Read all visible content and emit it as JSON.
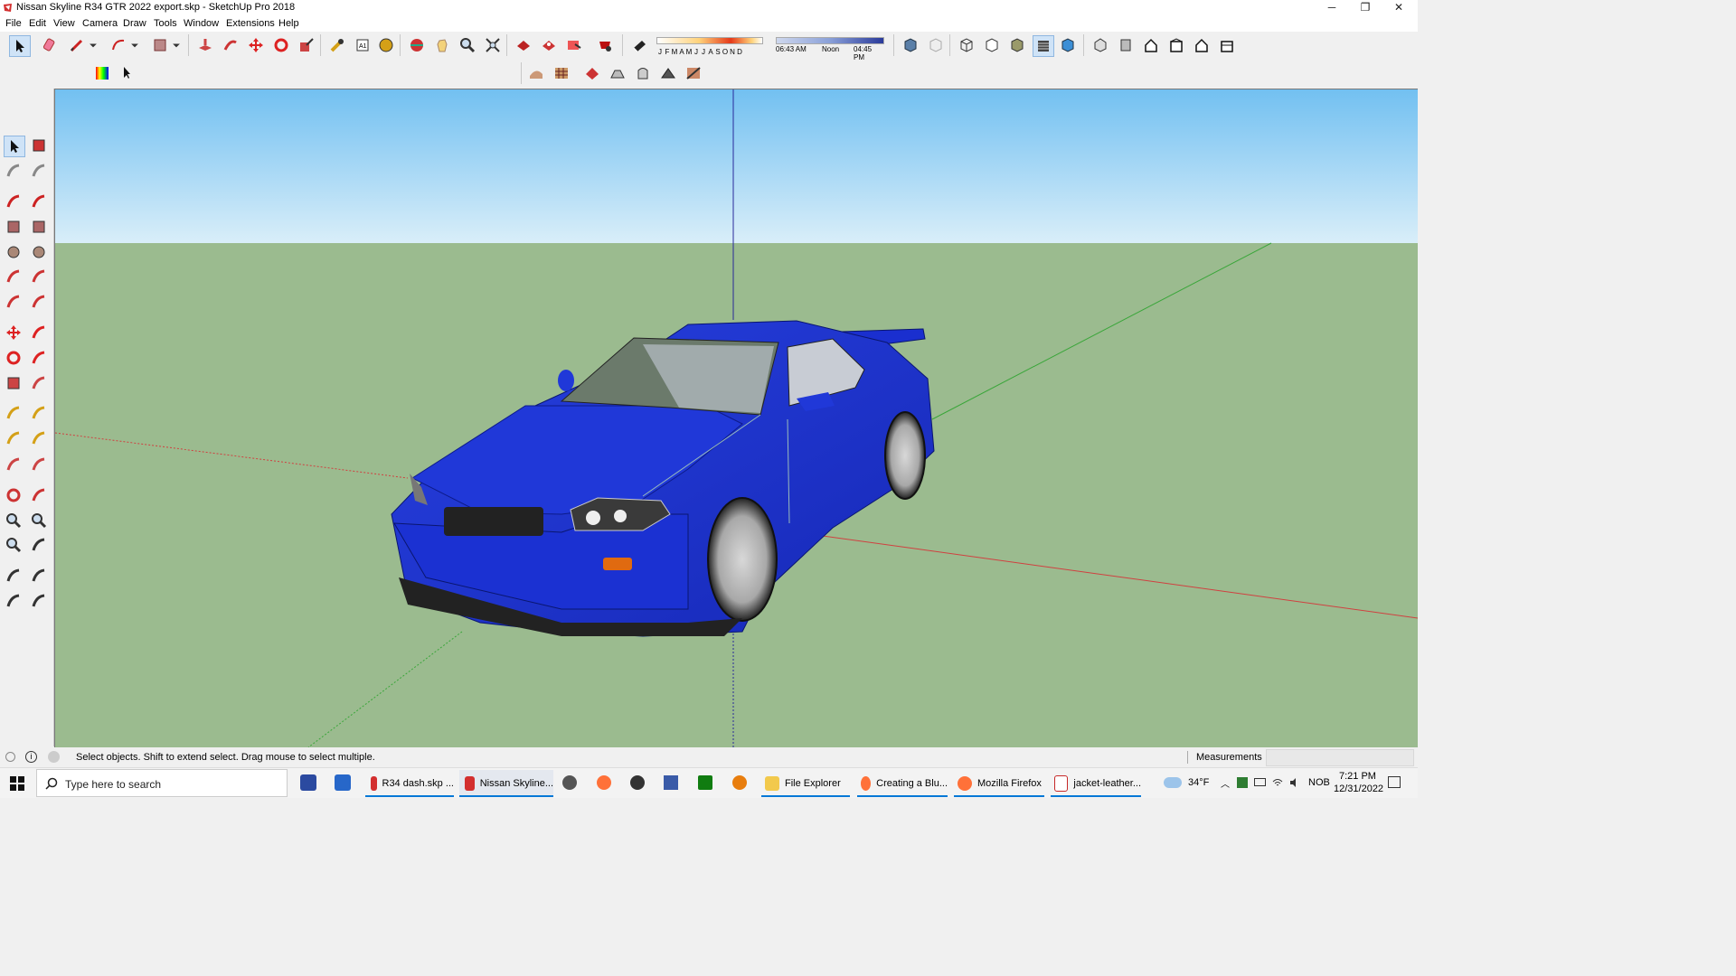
{
  "window": {
    "title": "Nissan Skyline R34 GTR 2022 export.skp - SketchUp Pro 2018",
    "minimize": "─",
    "restore": "❐",
    "close": "✕"
  },
  "menu": [
    "File",
    "Edit",
    "View",
    "Camera",
    "Draw",
    "Tools",
    "Window",
    "Extensions",
    "Help"
  ],
  "shadow": {
    "months": [
      "J",
      "F",
      "M",
      "A",
      "M",
      "J",
      "J",
      "A",
      "S",
      "O",
      "N",
      "D"
    ],
    "time_start": "06:43 AM",
    "time_mid": "Noon",
    "time_end": "04:45 PM"
  },
  "status": {
    "message": "Select objects. Shift to extend select. Drag mouse to select multiple.",
    "measurements_label": "Measurements",
    "measurements_value": ""
  },
  "taskbar": {
    "search_placeholder": "Type here to search",
    "apps": [
      {
        "label": "R34 dash.skp ...",
        "color": "#d32f2f",
        "active": true
      },
      {
        "label": "Nissan Skyline...",
        "color": "#d32f2f",
        "active": true
      },
      {
        "label": "File Explorer",
        "color": "#f2c94c",
        "active": true
      },
      {
        "label": "Creating a Blu...",
        "color": "#ff7139",
        "active": true
      },
      {
        "label": "Mozilla Firefox",
        "color": "#ff7139",
        "active": true
      },
      {
        "label": "jacket-leather...",
        "color": "#c62828",
        "active": true
      }
    ],
    "weather": "34°F",
    "lang": "NOB",
    "time": "7:21 PM",
    "date": "12/31/2022"
  },
  "colors": {
    "sky_top": "#6fbff0",
    "sky_bottom": "#d8eefa",
    "ground": "#9bbb8f",
    "car_body": "#1a2fcf",
    "axis_red": "#d04040",
    "axis_green": "#3aa63a",
    "axis_blue": "#2a2a9a"
  }
}
